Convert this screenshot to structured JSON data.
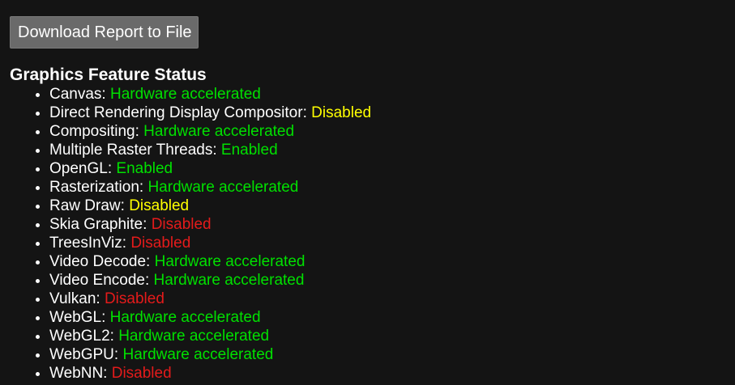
{
  "toolbar": {
    "download_label": "Download Report to File"
  },
  "section": {
    "title": "Graphics Feature Status"
  },
  "colors": {
    "enabled": "#00e000",
    "warning": "#ffff00",
    "disabled": "#e41b1b"
  },
  "features": [
    {
      "name": "Canvas",
      "status": "Hardware accelerated",
      "level": "green"
    },
    {
      "name": "Direct Rendering Display Compositor",
      "status": "Disabled",
      "level": "yellow"
    },
    {
      "name": "Compositing",
      "status": "Hardware accelerated",
      "level": "green"
    },
    {
      "name": "Multiple Raster Threads",
      "status": "Enabled",
      "level": "green"
    },
    {
      "name": "OpenGL",
      "status": "Enabled",
      "level": "green"
    },
    {
      "name": "Rasterization",
      "status": "Hardware accelerated",
      "level": "green"
    },
    {
      "name": "Raw Draw",
      "status": "Disabled",
      "level": "yellow"
    },
    {
      "name": "Skia Graphite",
      "status": "Disabled",
      "level": "red"
    },
    {
      "name": "TreesInViz",
      "status": "Disabled",
      "level": "red"
    },
    {
      "name": "Video Decode",
      "status": "Hardware accelerated",
      "level": "green"
    },
    {
      "name": "Video Encode",
      "status": "Hardware accelerated",
      "level": "green"
    },
    {
      "name": "Vulkan",
      "status": "Disabled",
      "level": "red"
    },
    {
      "name": "WebGL",
      "status": "Hardware accelerated",
      "level": "green"
    },
    {
      "name": "WebGL2",
      "status": "Hardware accelerated",
      "level": "green"
    },
    {
      "name": "WebGPU",
      "status": "Hardware accelerated",
      "level": "green"
    },
    {
      "name": "WebNN",
      "status": "Disabled",
      "level": "red"
    }
  ]
}
